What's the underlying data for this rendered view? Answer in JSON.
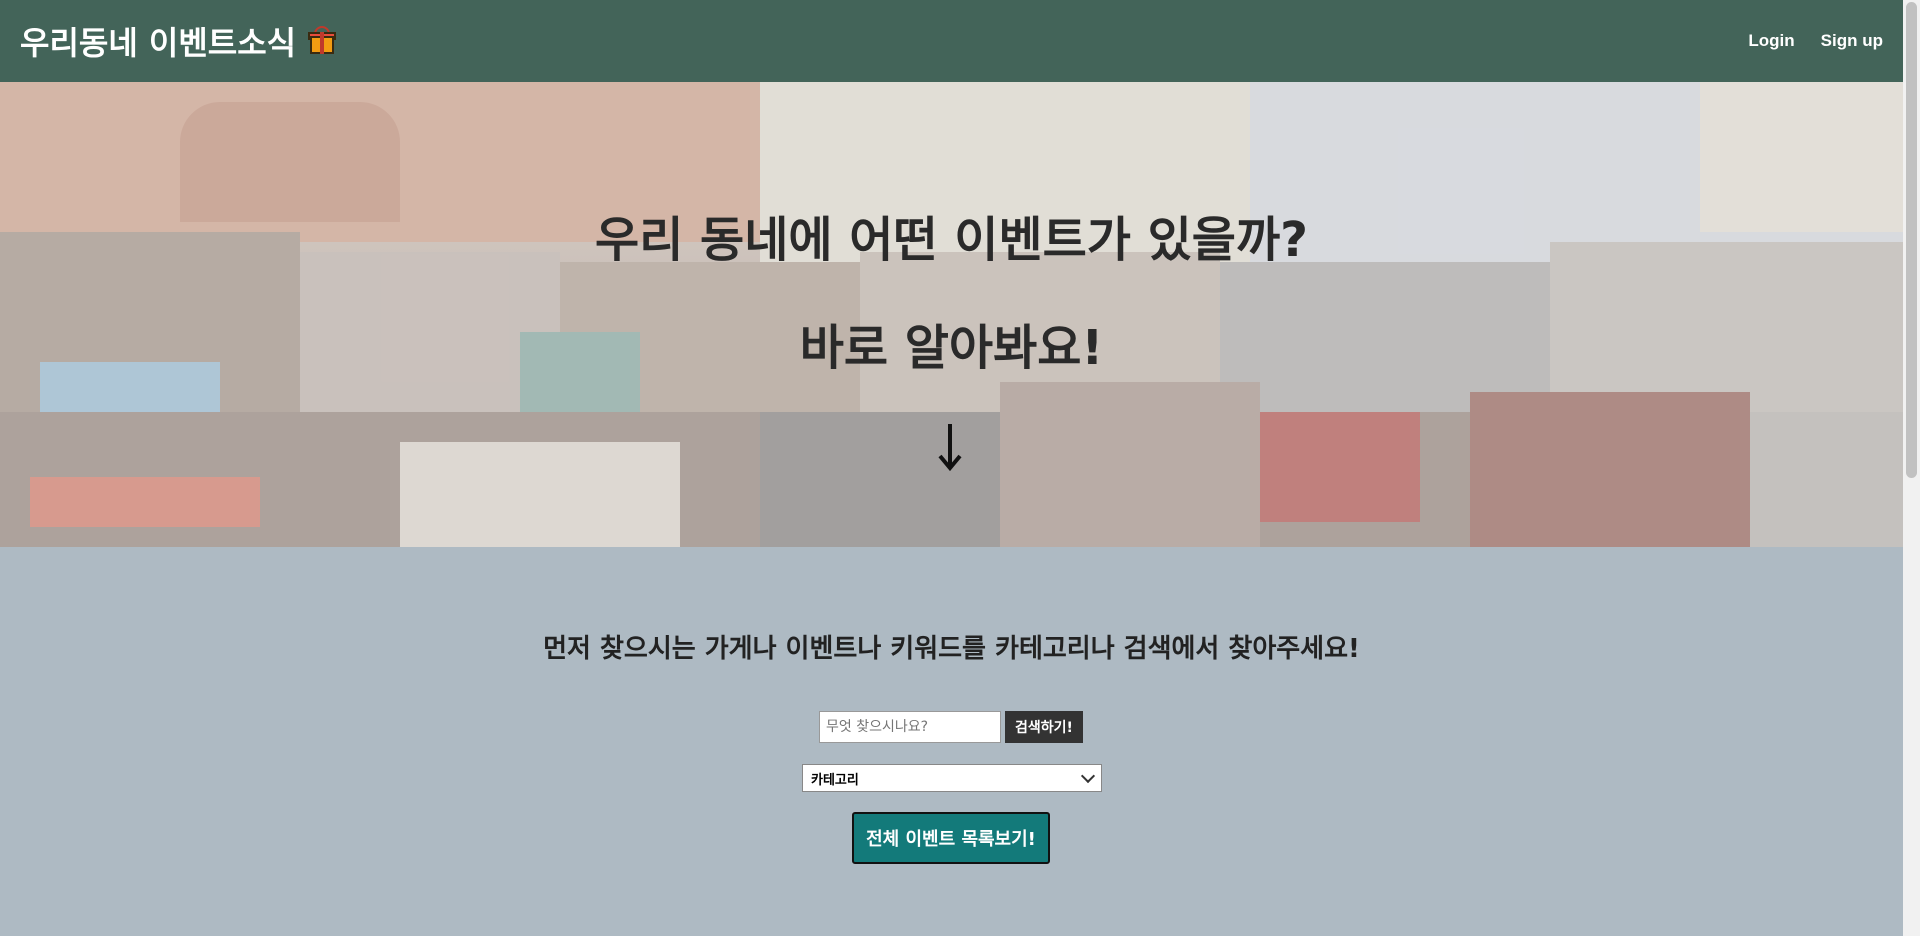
{
  "header": {
    "brand": "우리동네 이벤트소식",
    "nav": {
      "login": "Login",
      "signup": "Sign up"
    }
  },
  "hero": {
    "line1": "우리 동네에 어떤 이벤트가 있을까?",
    "line2": "바로 알아봐요!",
    "arrow_icon": "arrow-down-icon"
  },
  "search": {
    "prompt": "먼저 찾으시는 가게나 이벤트나 키워드를 카테고리나 검색에서 찾아주세요!",
    "placeholder": "무엇 찾으시나요?",
    "button": "검색하기!",
    "category_selected": "카테고리",
    "all_events_button": "전체 이벤트 목록보기!"
  },
  "colors": {
    "header_bg": "#436459",
    "page_bg": "#aebac3",
    "primary_button": "#137a7a"
  }
}
